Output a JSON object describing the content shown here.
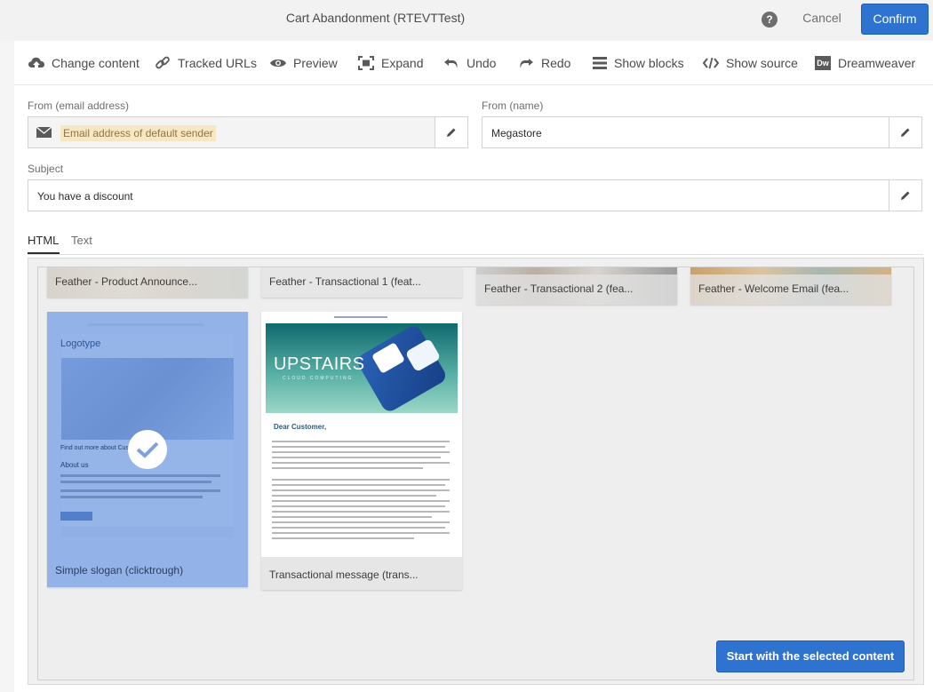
{
  "header": {
    "title": "Cart Abandonment (RTEVTTest)",
    "help_label": "?",
    "cancel_label": "Cancel",
    "confirm_label": "Confirm"
  },
  "toolbar": {
    "items": [
      {
        "label": "Change content",
        "icon": "cloud-upload-icon"
      },
      {
        "label": "Tracked URLs",
        "icon": "link-icon"
      },
      {
        "label": "Preview",
        "icon": "eye-icon"
      },
      {
        "label": "Expand",
        "icon": "expand-icon"
      },
      {
        "label": "Undo",
        "icon": "undo-icon"
      },
      {
        "label": "Redo",
        "icon": "redo-icon"
      },
      {
        "label": "Show blocks",
        "icon": "list-icon"
      },
      {
        "label": "Show source",
        "icon": "code-icon"
      },
      {
        "label": "Dreamweaver",
        "icon": "dreamweaver-icon",
        "icon_text": "Dw"
      }
    ]
  },
  "form": {
    "from_email": {
      "label": "From (email address)",
      "value": "Email address of default sender"
    },
    "from_name": {
      "label": "From (name)",
      "value": "Megastore"
    },
    "subject": {
      "label": "Subject",
      "value": "You have a discount"
    }
  },
  "tabs": [
    {
      "label": "HTML",
      "active": true
    },
    {
      "label": "Text",
      "active": false
    }
  ],
  "templates": [
    {
      "name": "Feather - Product Announce..."
    },
    {
      "name": "Feather - Transactional 1 (feat..."
    },
    {
      "name": "Feather - Transactional 2 (fea..."
    },
    {
      "name": "Feather - Welcome Email (fea..."
    },
    {
      "name": "Simple slogan (clicktrough)",
      "selected": true,
      "logo_text": "Logotype",
      "link_text": "Find out more about Cust",
      "about_text": "About us"
    },
    {
      "name": "Transactional message (trans...",
      "banner_text": "UPSTAIRS",
      "banner_sub": "CLOUD COMPUTING",
      "greeting": "Dear Customer,"
    }
  ],
  "start_button_label": "Start with the selected content",
  "colors": {
    "accent": "#2d73cf",
    "selection_overlay": "#8fb0e8",
    "sender_chip": "#f7e7c3"
  }
}
